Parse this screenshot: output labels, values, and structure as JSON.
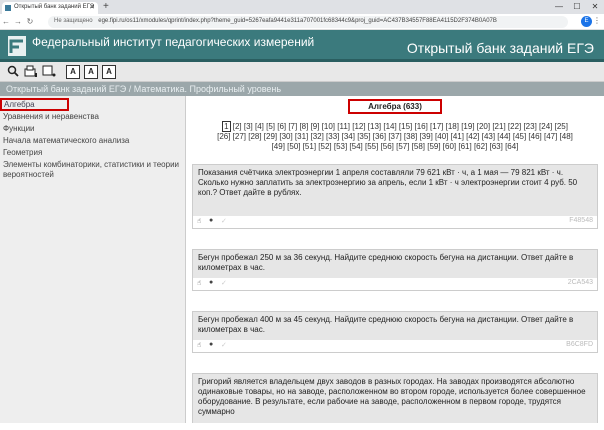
{
  "browser": {
    "tab_title": "Открытый банк заданий ЕГЭ",
    "new_tab": "+",
    "window_buttons": [
      "—",
      "☐",
      "✕"
    ],
    "insecure_label": "Не защищено",
    "url": "ege.fipi.ru/os11/xmodules/qprint/index.php?theme_guid=5267eafa9441e311a707001fc68344c9&proj_guid=AC437B34557F88EA4115D2F374B0A07B",
    "avatar_letter": "E"
  },
  "site": {
    "org_name": "Федеральный институт педагогических измерений",
    "bank_name": "Открытый банк заданий ЕГЭ",
    "toolbar": {
      "font_a1": "A",
      "font_a2": "A",
      "font_a3": "A"
    },
    "breadcrumb": "Открытый банк заданий ЕГЭ / Математика. Профильный уровень"
  },
  "sidebar": {
    "items": [
      {
        "label": "Алгебра",
        "active": true
      },
      {
        "label": "Уравнения и неравенства"
      },
      {
        "label": "Функции"
      },
      {
        "label": "Начала математического анализа"
      },
      {
        "label": "Геометрия"
      },
      {
        "label": "Элементы комбинаторики, статистики и теории вероятностей"
      }
    ]
  },
  "main": {
    "category_title": "Алгебра (633)",
    "current_page": "1",
    "pages_line1": "[2] [3] [4] [5] [6] [7] [8] [9] [10] [11] [12] [13] [14] [15] [16] [17] [18] [19] [20] [21] [22] [23] [24] [25]",
    "pages_line2": "[26] [27] [28] [29] [30] [31] [32] [33] [34] [35] [36] [37] [38] [39] [40] [41] [42] [43] [44] [45] [46] [47] [48]",
    "pages_line3": "[49] [50] [51] [52] [53] [54] [55] [56] [57] [58] [59] [60] [61] [62] [63] [64]",
    "tasks": [
      {
        "text": "Показания счётчика электроэнергии 1 апреля составляли 79 621 кВт · ч, а 1 мая — 79 821 кВт · ч. Сколько нужно заплатить за электроэнергию за апрель, если 1 кВт · ч электроэнергии стоит 4 руб. 50 коп.? Ответ дайте в рублях.",
        "code": "F48548"
      },
      {
        "text": "Бегун пробежал 250 м за 36 секунд. Найдите среднюю скорость бегуна на дистанции. Ответ дайте в километрах в час.",
        "code": "2CA543"
      },
      {
        "text": "Бегун пробежал 400 м за 45 секунд. Найдите среднюю скорость бегуна на дистанции. Ответ дайте в километрах в час.",
        "code": "B6C8FD"
      },
      {
        "text": "Григорий является владельцем двух заводов в разных городах. На заводах производятся абсолютно одинаковые товары, но на заводе, расположенном во втором городе, используется более совершенное оборудование. В результате, если рабочие на заводе, расположенном в первом городе, трудятся суммарно",
        "code": ""
      }
    ]
  }
}
